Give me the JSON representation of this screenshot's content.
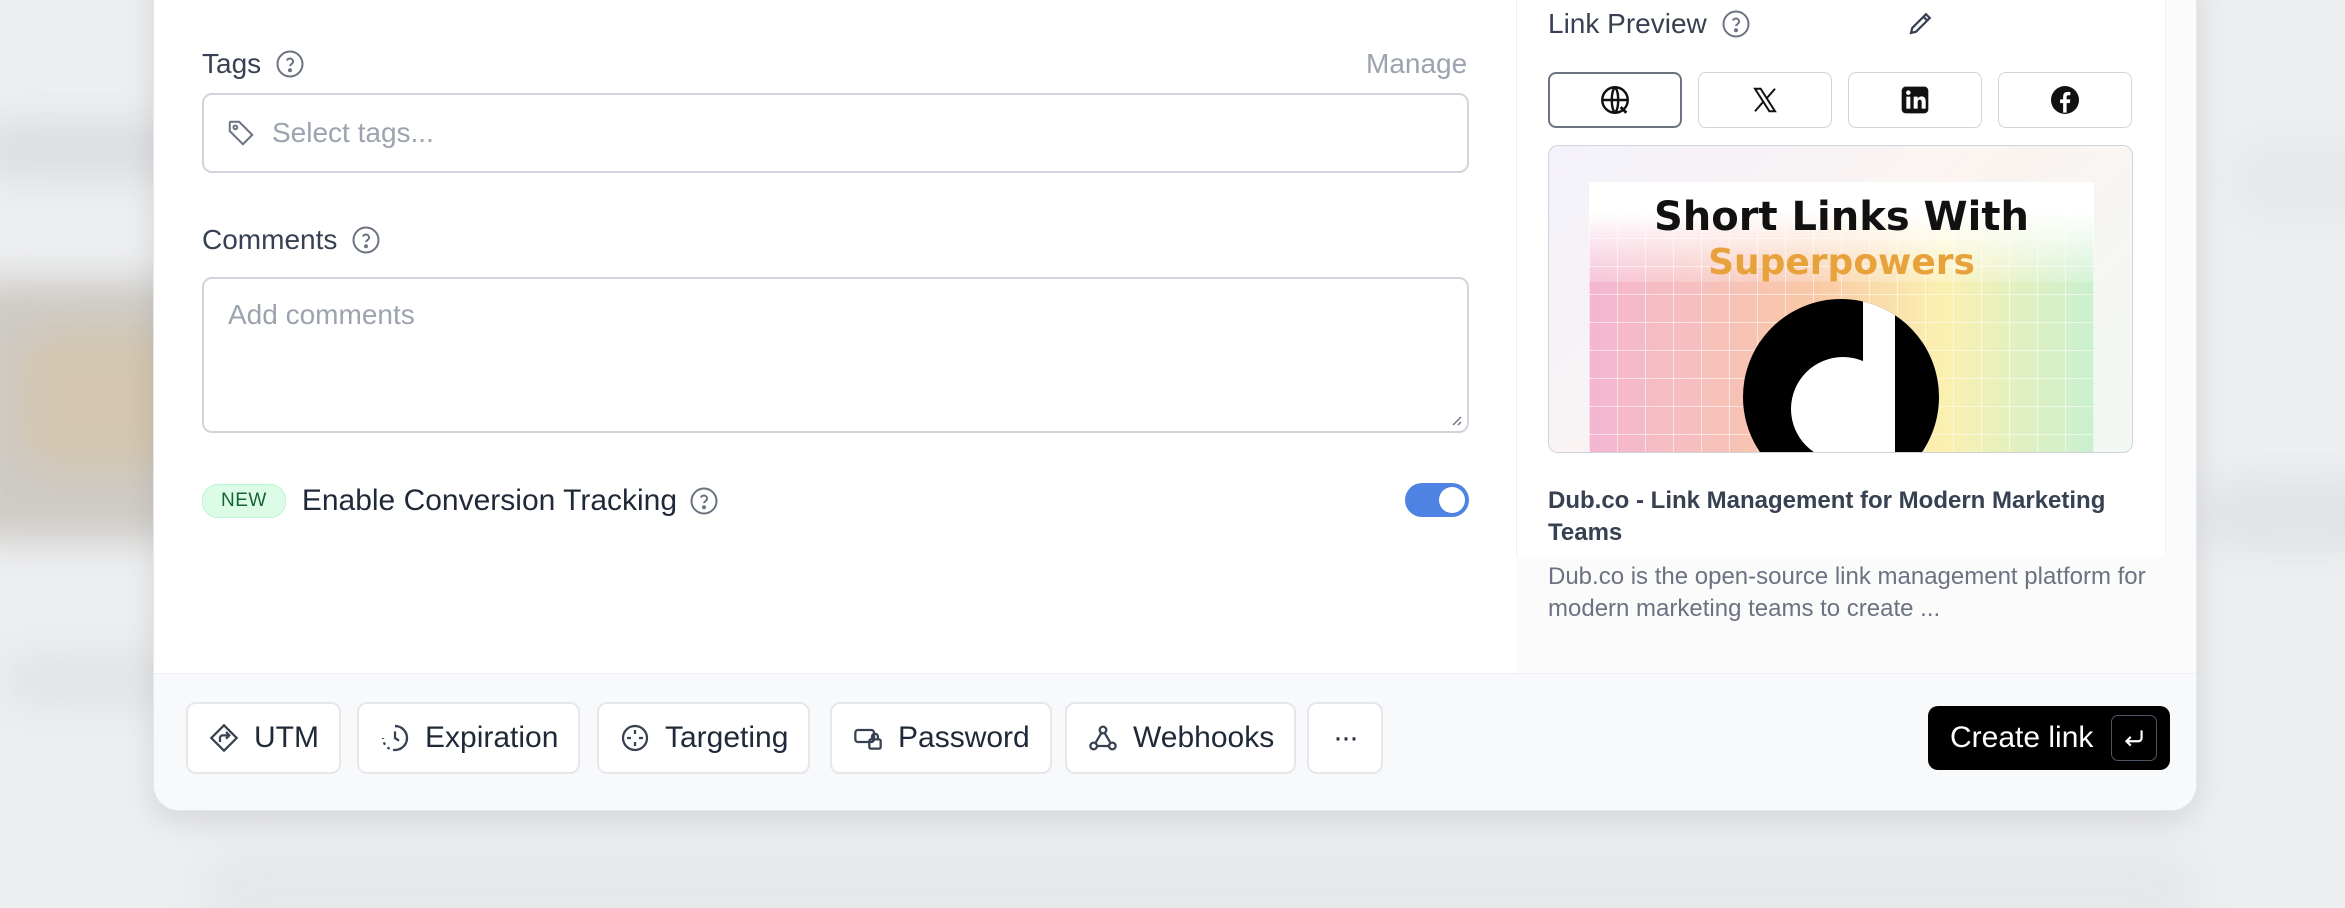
{
  "tags": {
    "label": "Tags",
    "manage_label": "Manage",
    "placeholder": "Select tags..."
  },
  "comments": {
    "label": "Comments",
    "placeholder": "Add comments"
  },
  "conversion": {
    "badge": "NEW",
    "label": "Enable Conversion Tracking",
    "enabled": true
  },
  "link_preview": {
    "title": "Link Preview",
    "tabs": [
      "web",
      "x",
      "linkedin",
      "facebook"
    ],
    "og_line1": "Short Links With",
    "og_line2": "Superpowers",
    "headline": "Dub.co - Link Management for Modern Marketing Teams",
    "description": "Dub.co is the open-source link management platform for modern marketing teams to create ..."
  },
  "footer": {
    "buttons": [
      {
        "label": "UTM",
        "icon": "utm-icon"
      },
      {
        "label": "Expiration",
        "icon": "clock-icon"
      },
      {
        "label": "Targeting",
        "icon": "crosshair-icon"
      },
      {
        "label": "Password",
        "icon": "lock-icon"
      },
      {
        "label": "Webhooks",
        "icon": "webhook-icon"
      }
    ],
    "more_label": "···",
    "create_label": "Create link"
  },
  "colors": {
    "toggle_on": "#4f83e3",
    "badge_green": "#166534",
    "accent_orange": "#e8a23b"
  }
}
